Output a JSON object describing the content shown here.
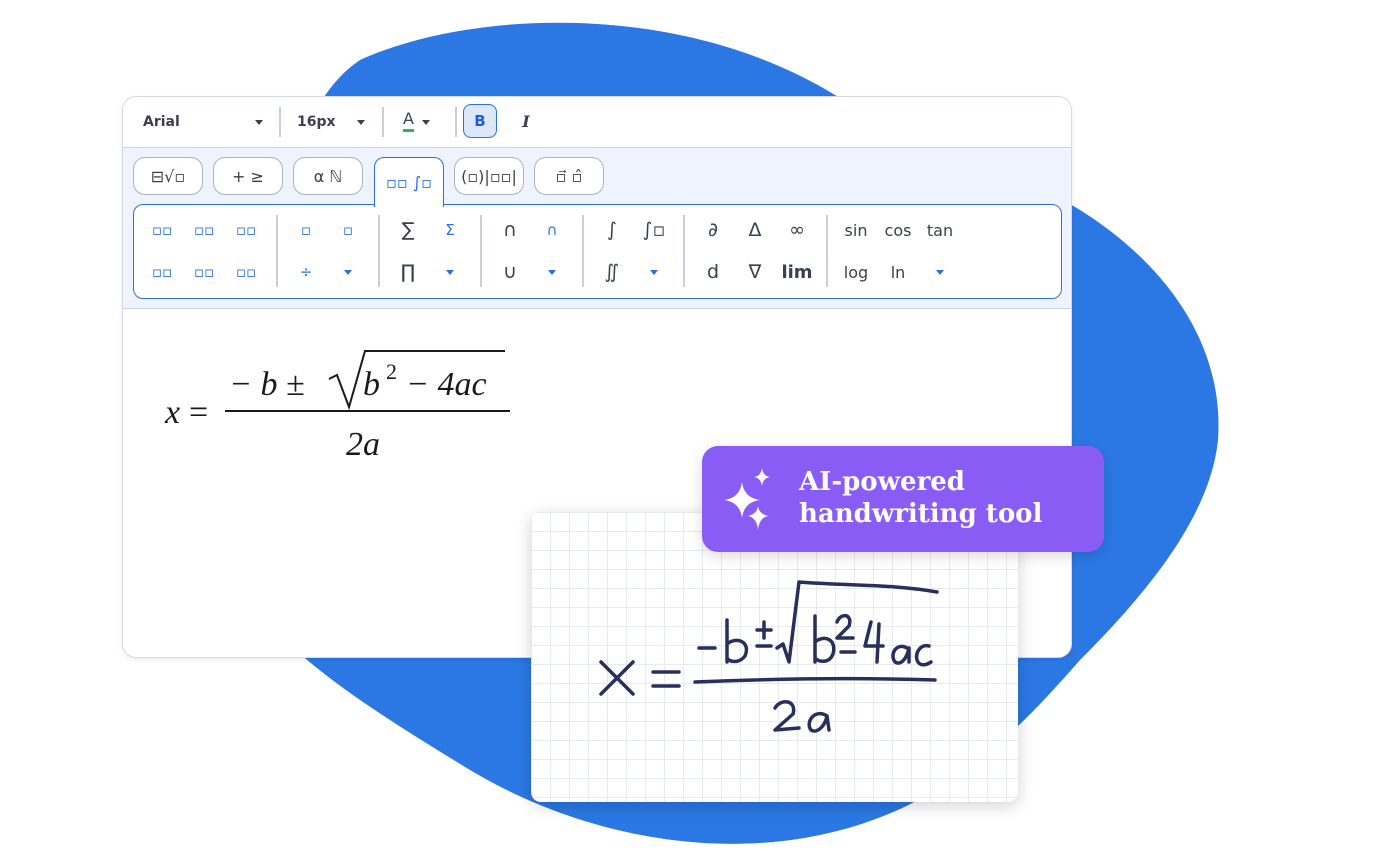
{
  "colors": {
    "blob": "#2b78e4",
    "accent": "#2b6fe0",
    "badge": "#8a5cf6",
    "ink": "#27305a"
  },
  "toolbar": {
    "font_family": "Arial",
    "font_size": "16px",
    "color_label": "A",
    "bold_label": "B",
    "italic_label": "I"
  },
  "tabs": [
    "⊟√▫",
    "+ ≥",
    "α ℕ",
    "▫▫ ∫▫",
    "(▫)|▫▫|",
    "▫⃗ ▫̂"
  ],
  "palette": {
    "row1": [
      "▫▫",
      "▫▫",
      "▫▫",
      "▫",
      "▫",
      "∑",
      "Σ",
      "∩",
      "∩",
      "∫",
      "∫▫",
      "∂",
      "Δ",
      "∞",
      "sin",
      "cos",
      "tan"
    ],
    "row2": [
      "▫▫",
      "▫▫",
      "▫▫",
      "÷",
      "",
      "∏",
      "",
      "∪",
      "",
      "∬",
      "",
      "d",
      "∇",
      "lim",
      "log",
      "ln",
      ""
    ]
  },
  "formula": {
    "lhs": "x",
    "equals": "=",
    "numerator_minus_b": "− b ±",
    "radicand_b": "b",
    "exponent": "2",
    "radicand_rest": "− 4ac",
    "denominator": "2a"
  },
  "badge": {
    "line1": "AI-powered",
    "line2": "handwriting tool"
  }
}
